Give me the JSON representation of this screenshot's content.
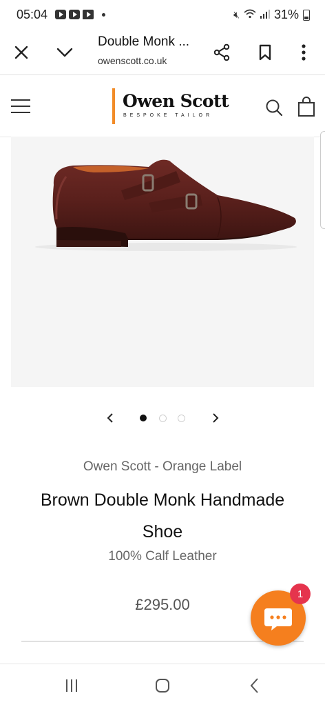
{
  "status_bar": {
    "time": "05:04",
    "battery": "31%",
    "app_icons": [
      "youtube-icon",
      "youtube-icon",
      "twitch-icon"
    ]
  },
  "browser": {
    "page_title": "Double Monk ...",
    "url": "owenscott.co.uk"
  },
  "header": {
    "logo_name": "Owen Scott",
    "logo_tagline": "BESPOKE TAILOR",
    "logo_accent": "#f28c28"
  },
  "carousel": {
    "slide_count": 3,
    "active_index": 0
  },
  "product": {
    "vendor": "Owen Scott - Orange Label",
    "title": "Brown Double Monk Handmade Shoe",
    "material": "100% Calf Leather",
    "price": "£295.00"
  },
  "chat": {
    "badge_count": "1",
    "button_color": "#f57f1e",
    "badge_color": "#e5344d"
  }
}
